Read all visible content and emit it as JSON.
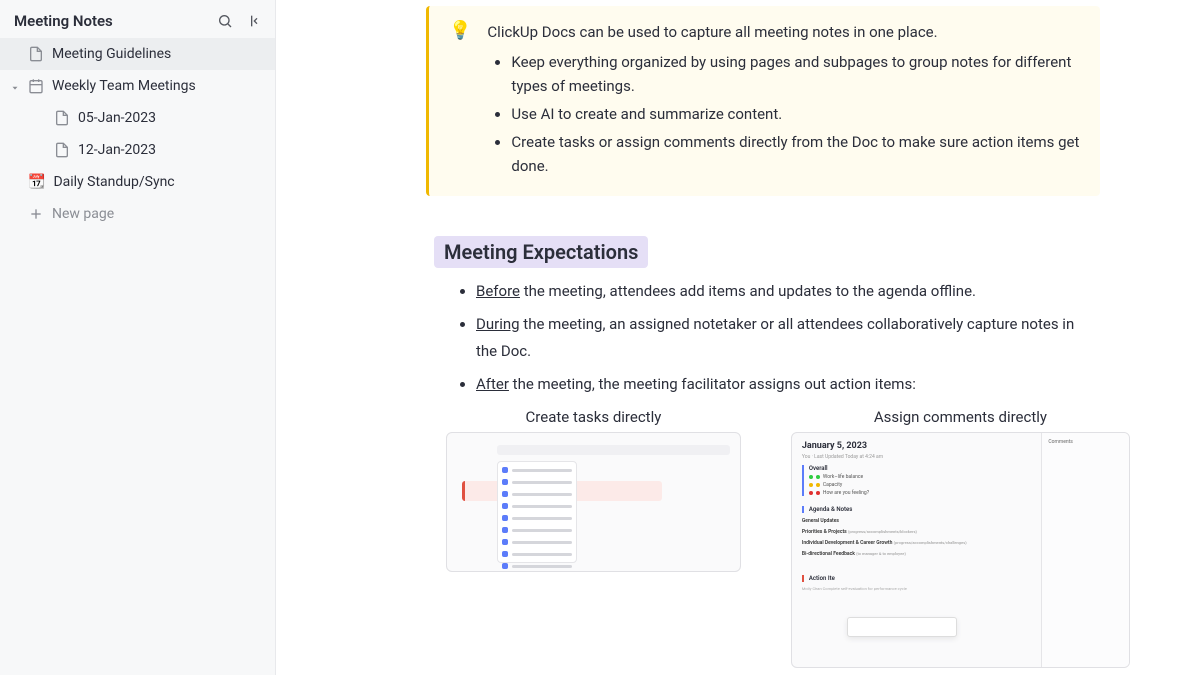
{
  "sidebar": {
    "title": "Meeting Notes",
    "items": [
      {
        "icon": "doc",
        "label": "Meeting Guidelines",
        "active": true
      },
      {
        "icon": "calendar",
        "label": "Weekly Team Meetings",
        "expanded": true
      },
      {
        "icon": "doc",
        "label": "05-Jan-2023"
      },
      {
        "icon": "doc",
        "label": "12-Jan-2023"
      },
      {
        "emoji": "📆",
        "label": "Daily Standup/Sync"
      }
    ],
    "new_page": "New page"
  },
  "callout": {
    "icon": "💡",
    "intro": "ClickUp Docs can be used to capture all meeting notes in one place.",
    "bullets": [
      "Keep everything organized by using pages and subpages to group notes for different types of meetings.",
      "Use AI to create and summarize content.",
      "Create tasks or assign comments directly from the Doc to make sure action items get done."
    ]
  },
  "heading": "Meeting Expectations",
  "expectations": {
    "before_u": "Before",
    "before_rest": " the meeting, attendees add items and updates to the agenda offline.",
    "during_u": "During",
    "during_rest": " the meeting, an assigned notetaker or all attendees collaboratively capture notes in the Doc.",
    "after_u": "After",
    "after_rest": " the meeting, the meeting facilitator assigns out action items:"
  },
  "images": {
    "left_caption": "Create tasks directly",
    "right_caption": "Assign comments directly",
    "right_date": "January 5, 2023",
    "right_overall": "Overall",
    "right_agenda": "Agenda & Notes",
    "right_comments": "Comments"
  }
}
